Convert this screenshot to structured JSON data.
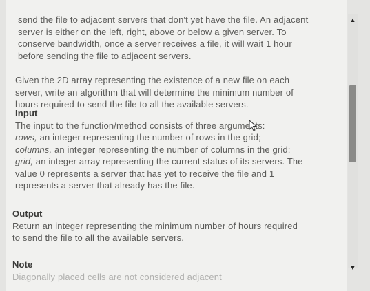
{
  "para1": {
    "lines": [
      "send the file to adjacent servers that don't yet have the file. An adjacent",
      "server is either on the left, right, above or below a given server. To",
      "conserve bandwidth, once a server receives a file, it will wait 1 hour",
      "before sending the file to adjacent servers."
    ]
  },
  "para2": {
    "lines": [
      "Given the 2D array representing the existence of a new file on each",
      "server, write an algorithm that will determine the minimum number of",
      "hours required to send the file to all the available servers."
    ]
  },
  "input": {
    "heading": "Input",
    "line1": "The input to the function/method consists of three arguments:",
    "rows_term": "rows,",
    "rows_desc": " an integer representing the number of rows in the grid;",
    "columns_term": "columns,",
    "columns_desc": " an integer representing the number of columns in the grid;",
    "grid_term": "grid,",
    "grid_desc": " an integer array representing the current status of its servers. The",
    "line5": "value 0 represents a server that has yet to receive the file and 1",
    "line6": "represents a server that already has the file."
  },
  "output": {
    "heading": "Output",
    "lines": [
      "Return an integer representing the minimum number of hours required",
      "to send the file to all the available servers."
    ]
  },
  "note": {
    "heading": "Note",
    "cut_line": "Diagonally placed cells are not considered adjacent"
  },
  "scroll": {
    "up_icon": "▲",
    "down_icon": "▼",
    "position_fraction": 0.35
  }
}
